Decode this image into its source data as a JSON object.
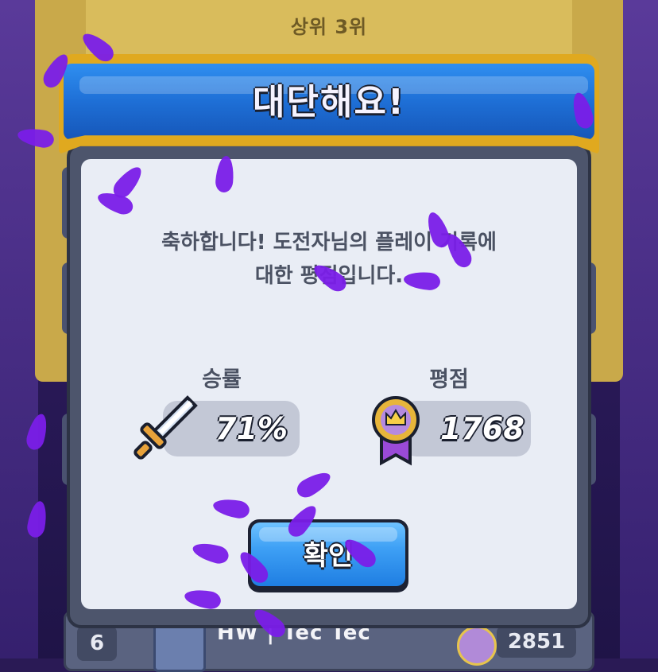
{
  "background": {
    "rank_label": "상위 3위",
    "leaderboard_row": {
      "rank": "6",
      "name": "HW | Tec Tec",
      "score": "2851"
    }
  },
  "modal": {
    "title": "대단해요!",
    "message": "축하합니다! 도전자님의 플레이 기록에\n대한 평점입니다.",
    "stats": {
      "win_rate_label": "승률",
      "win_rate_value": "71%",
      "win_rate_icon": "sword-icon",
      "rating_label": "평점",
      "rating_value": "1768",
      "rating_icon": "crown-medal-icon"
    },
    "confirm_label": "확인"
  },
  "colors": {
    "banner_blue": "#1e6fd6",
    "banner_gold": "#e0a91f",
    "confirm_blue": "#3ea0f5",
    "petal": "#7a1ee8"
  }
}
